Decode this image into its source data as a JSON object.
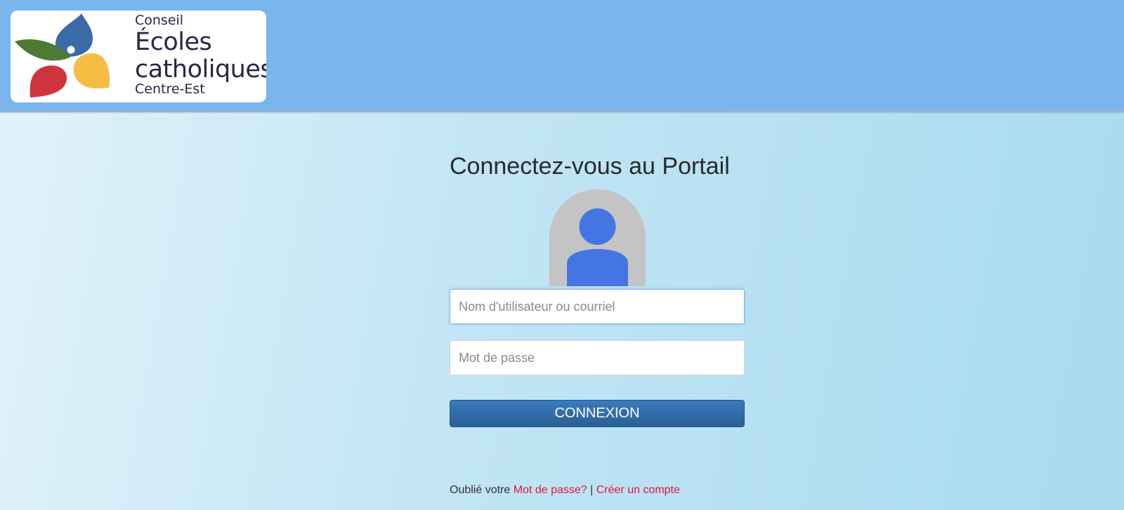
{
  "logo": {
    "line1": "Conseil",
    "line2": "Écoles",
    "line3": "catholiques",
    "line4": "Centre-Est",
    "colors": {
      "blue": "#3a6aa7",
      "green": "#4f7a35",
      "red": "#d0343f",
      "yellow": "#f6bd45",
      "text": "#2a2548"
    }
  },
  "login": {
    "title": "Connectez-vous au Portail",
    "avatar_icon": "user-icon",
    "username_placeholder": "Nom d'utilisateur ou courriel",
    "password_placeholder": "Mot de passe",
    "submit_label": "CONNEXION"
  },
  "footer": {
    "forgot_prefix": "Oublié votre",
    "forgot_link": "Mot de passe?",
    "separator": "|",
    "create_link": "Créer un compte"
  },
  "colors": {
    "header_bg": "#7ab5ee",
    "button_bg": "#2f6ba5",
    "link": "#e3143c",
    "avatar_bg": "#c4c4c4",
    "avatar_figure": "#4575e0"
  }
}
